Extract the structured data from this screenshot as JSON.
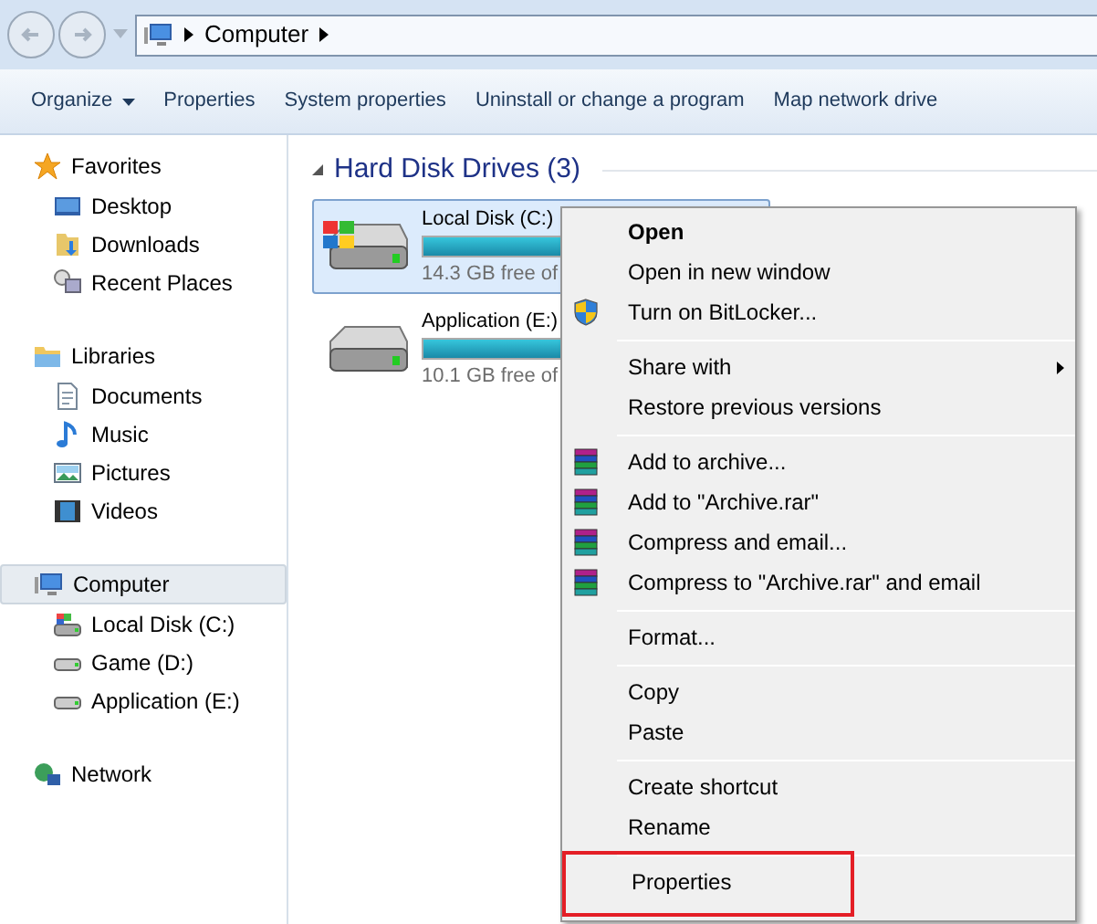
{
  "address_bar": {
    "crumbs": [
      "Computer"
    ]
  },
  "toolbar": [
    {
      "label": "Organize",
      "dropdown": true
    },
    {
      "label": "Properties",
      "dropdown": false
    },
    {
      "label": "System properties",
      "dropdown": false
    },
    {
      "label": "Uninstall or change a program",
      "dropdown": false
    },
    {
      "label": "Map network drive",
      "dropdown": false
    }
  ],
  "sidebar": [
    {
      "label": "Favorites",
      "kind": "star",
      "selected": false,
      "children": [
        {
          "label": "Desktop",
          "kind": "desktop",
          "selected": false
        },
        {
          "label": "Downloads",
          "kind": "downloads",
          "selected": false
        },
        {
          "label": "Recent Places",
          "kind": "recent",
          "selected": false
        }
      ]
    },
    {
      "label": "Libraries",
      "kind": "folder",
      "selected": false,
      "children": [
        {
          "label": "Documents",
          "kind": "document",
          "selected": false
        },
        {
          "label": "Music",
          "kind": "music",
          "selected": false
        },
        {
          "label": "Pictures",
          "kind": "pictures",
          "selected": false
        },
        {
          "label": "Videos",
          "kind": "videos",
          "selected": false
        }
      ]
    },
    {
      "label": "Computer",
      "kind": "computer",
      "selected": true,
      "children": [
        {
          "label": "Local Disk (C:)",
          "kind": "system-disk",
          "selected": false
        },
        {
          "label": "Game (D:)",
          "kind": "disk",
          "selected": false
        },
        {
          "label": "Application (E:)",
          "kind": "disk",
          "selected": false
        }
      ]
    },
    {
      "label": "Network",
      "kind": "network",
      "selected": false
    }
  ],
  "content": {
    "group_title": "Hard Disk Drives (3)",
    "drives": [
      {
        "name": "Local Disk (C:)",
        "free": "14.3 GB free of",
        "level": 0.8,
        "selected": true,
        "kind": "system-disk"
      },
      {
        "name": "Application (E:)",
        "free": "10.1 GB free of",
        "level": 0.7,
        "selected": false,
        "kind": "disk"
      }
    ]
  },
  "context_menu": {
    "sections": [
      [
        {
          "label": "Open",
          "kind": "default",
          "boxed": false
        },
        {
          "label": "Open in new window",
          "kind": "plain",
          "boxed": false
        },
        {
          "label": "Turn on BitLocker...",
          "kind": "shield",
          "boxed": false
        }
      ],
      [
        {
          "label": "Share with",
          "kind": "submenu",
          "boxed": false
        },
        {
          "label": "Restore previous versions",
          "kind": "plain",
          "boxed": false
        }
      ],
      [
        {
          "label": "Add to archive...",
          "kind": "archive",
          "boxed": false
        },
        {
          "label": "Add to \"Archive.rar\"",
          "kind": "archive",
          "boxed": false
        },
        {
          "label": "Compress and email...",
          "kind": "archive",
          "boxed": false
        },
        {
          "label": "Compress to \"Archive.rar\" and email",
          "kind": "archive",
          "boxed": false
        }
      ],
      [
        {
          "label": "Format...",
          "kind": "plain",
          "boxed": false
        }
      ],
      [
        {
          "label": "Copy",
          "kind": "plain",
          "boxed": false
        },
        {
          "label": "Paste",
          "kind": "plain",
          "boxed": false
        }
      ],
      [
        {
          "label": "Create shortcut",
          "kind": "plain",
          "boxed": false
        },
        {
          "label": "Rename",
          "kind": "plain",
          "boxed": false
        }
      ],
      [
        {
          "label": "Properties",
          "kind": "plain",
          "boxed": true
        }
      ]
    ]
  }
}
